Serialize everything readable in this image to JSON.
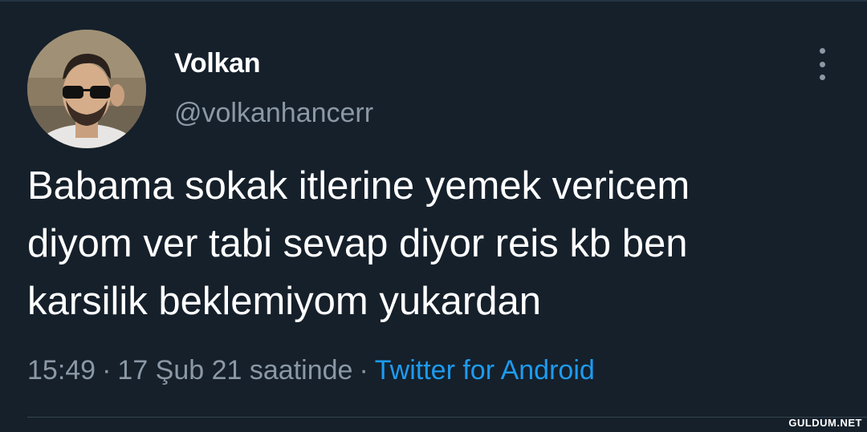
{
  "user": {
    "display_name": "Volkan",
    "handle": "@volkanhancerr"
  },
  "tweet": {
    "text": "Babama sokak itlerine yemek vericem\ndiyom ver tabi sevap diyor reis kb ben\nkarsilik beklemiyom yukardan",
    "time": "15:49",
    "separator": "·",
    "date": "17 Şub 21 saatinde",
    "source": "Twitter for Android"
  },
  "icons": {
    "more": "more-vertical-icon",
    "avatar": "profile-photo"
  },
  "watermark": "GULDUM.NET",
  "colors": {
    "background": "#15202b",
    "text": "#ffffff",
    "muted": "#8b98a5",
    "link": "#1d9bf0"
  }
}
